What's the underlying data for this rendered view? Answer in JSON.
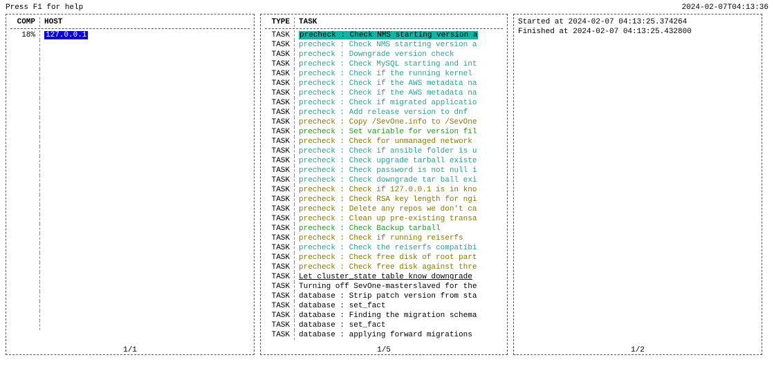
{
  "top": {
    "help": "Press F1 for help",
    "clock": "2024-02-07T04:13:36"
  },
  "left": {
    "hdr_comp": "COMP",
    "hdr_host": "HOST",
    "rows": [
      {
        "comp": "18%",
        "host": "127.0.0.1",
        "selected": true
      }
    ],
    "pager": "1/1"
  },
  "mid": {
    "hdr_type": "TYPE",
    "hdr_task": "TASK",
    "rows": [
      {
        "type": "TASK",
        "text": "precheck : Check NMS starting version a",
        "cls": "sel-task"
      },
      {
        "type": "TASK",
        "text": "precheck : Check NMS starting version a",
        "cls": "c-cyan"
      },
      {
        "type": "TASK",
        "text": "precheck : Downgrade version check",
        "cls": "c-cyan"
      },
      {
        "type": "TASK",
        "text": "precheck : Check MySQL starting and int",
        "cls": "c-cyan"
      },
      {
        "type": "TASK",
        "text": "precheck : Check if the running kernel",
        "cls": "c-cyan"
      },
      {
        "type": "TASK",
        "text": "precheck : Check if the AWS metadata na",
        "cls": "c-cyan"
      },
      {
        "type": "TASK",
        "text": "precheck : Check if the AWS metadata na",
        "cls": "c-cyan"
      },
      {
        "type": "TASK",
        "text": "precheck : Check if migrated applicatio",
        "cls": "c-cyan"
      },
      {
        "type": "TASK",
        "text": "precheck : Add release version to dnf",
        "cls": "c-cyan"
      },
      {
        "type": "TASK",
        "text": "precheck : Copy /SevOne.info to /SevOne",
        "cls": "c-olive"
      },
      {
        "type": "TASK",
        "text": "precheck : Set variable for version fil",
        "cls": "c-green"
      },
      {
        "type": "TASK",
        "text": "precheck : Check for unmanaged network",
        "cls": "c-olive"
      },
      {
        "type": "TASK",
        "text": "precheck : Check if ansible folder is u",
        "cls": "c-cyan"
      },
      {
        "type": "TASK",
        "text": "precheck : Check upgrade tarball existe",
        "cls": "c-cyan"
      },
      {
        "type": "TASK",
        "text": "precheck : Check password is not null i",
        "cls": "c-cyan"
      },
      {
        "type": "TASK",
        "text": "precheck : Check downgrade tar ball exi",
        "cls": "c-cyan"
      },
      {
        "type": "TASK",
        "text": "precheck : Check if 127.0.0.1 is in kno",
        "cls": "c-olive"
      },
      {
        "type": "TASK",
        "text": "precheck : Check RSA key length for ngi",
        "cls": "c-olive"
      },
      {
        "type": "TASK",
        "text": "precheck : Delete any repos we don't ca",
        "cls": "c-olive"
      },
      {
        "type": "TASK",
        "text": "precheck : Clean up pre-existing transa",
        "cls": "c-olive"
      },
      {
        "type": "TASK",
        "text": "precheck : Check Backup tarball",
        "cls": "c-green"
      },
      {
        "type": "TASK",
        "text": "precheck : Check if running reiserfs",
        "cls": "c-olive"
      },
      {
        "type": "TASK",
        "text": "precheck : Check the reiserfs compatibi",
        "cls": "c-cyan"
      },
      {
        "type": "TASK",
        "text": "precheck : Check free disk of root part",
        "cls": "c-olive"
      },
      {
        "type": "TASK",
        "text": "precheck : Check free disk against thre",
        "cls": "c-olive"
      },
      {
        "type": "TASK",
        "text": "Let cluster_state table know downgrade",
        "cls": "c-black underline"
      },
      {
        "type": "TASK",
        "text": "Turning off SevOne-masterslaved for the",
        "cls": "c-black"
      },
      {
        "type": "TASK",
        "text": "database : Strip patch version from sta",
        "cls": "c-black"
      },
      {
        "type": "TASK",
        "text": "database : set_fact",
        "cls": "c-black"
      },
      {
        "type": "TASK",
        "text": "database : Finding the migration schema",
        "cls": "c-black"
      },
      {
        "type": "TASK",
        "text": "database : set_fact",
        "cls": "c-black"
      },
      {
        "type": "TASK",
        "text": "database : applying forward migrations",
        "cls": "c-black"
      }
    ],
    "pager": "1/5"
  },
  "right": {
    "lines": [
      "Started at 2024-02-07 04:13:25.374264",
      "Finished at 2024-02-07 04:13:25.432800"
    ],
    "pager": "1/2"
  }
}
